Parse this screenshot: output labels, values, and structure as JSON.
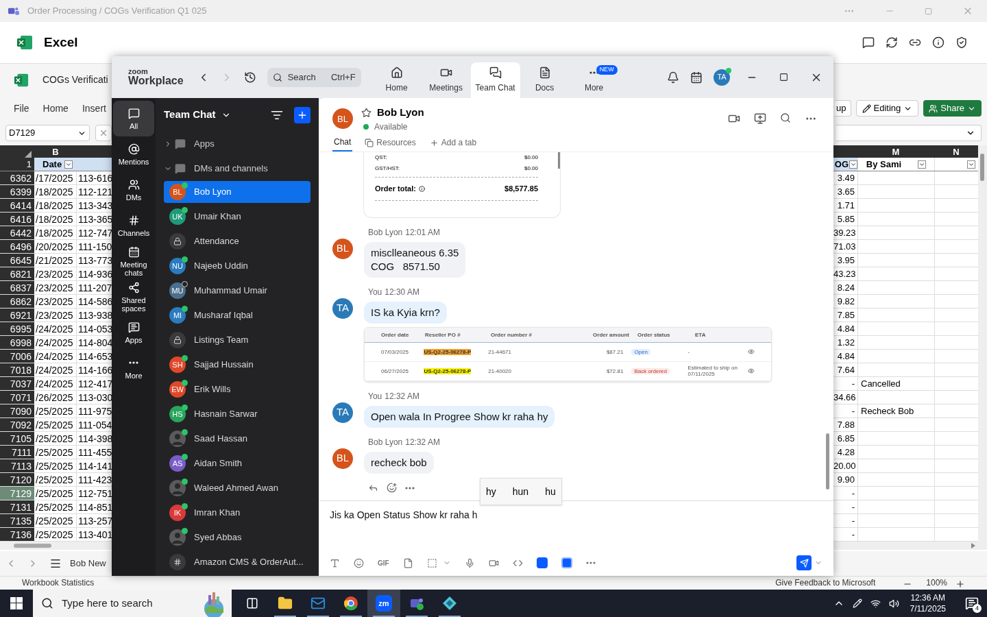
{
  "teams_title": "Order Processing / COGs Verification Q1 025",
  "excel": {
    "app_name": "Excel",
    "file_name": "COGs Verificati",
    "ribbon_tabs": [
      "File",
      "Home",
      "Insert"
    ],
    "up_button": "up",
    "editing_button": "Editing",
    "share_button": "Share",
    "name_box": "D7129",
    "columns": {
      "left": "B",
      "mid": "M",
      "right": "N"
    },
    "header": {
      "row": "1",
      "date": "Date",
      "col_l": "OG",
      "col_m": "By Sami"
    },
    "rows": [
      {
        "row": "6362",
        "date": "/17/2025",
        "order": "113-616",
        "cog": "3.49",
        "selected": false
      },
      {
        "row": "6399",
        "date": "/18/2025",
        "order": "112-121",
        "cog": "3.65",
        "selected": false
      },
      {
        "row": "6414",
        "date": "/18/2025",
        "order": "113-343",
        "cog": "1.71",
        "selected": false
      },
      {
        "row": "6416",
        "date": "/18/2025",
        "order": "113-365",
        "cog": "5.85",
        "selected": false
      },
      {
        "row": "6442",
        "date": "/18/2025",
        "order": "112-747",
        "cog": "39.23",
        "selected": false
      },
      {
        "row": "6496",
        "date": "/20/2025",
        "order": "111-150",
        "cog": "71.03",
        "selected": false
      },
      {
        "row": "6645",
        "date": "/21/2025",
        "order": "113-773",
        "cog": "3.95",
        "selected": false
      },
      {
        "row": "6821",
        "date": "/23/2025",
        "order": "114-936",
        "cog": "43.23",
        "selected": false
      },
      {
        "row": "6837",
        "date": "/23/2025",
        "order": "111-207",
        "cog": "8.24",
        "selected": false
      },
      {
        "row": "6862",
        "date": "/23/2025",
        "order": "114-586",
        "cog": "9.82",
        "selected": false
      },
      {
        "row": "6921",
        "date": "/23/2025",
        "order": "113-938",
        "cog": "7.85",
        "selected": false
      },
      {
        "row": "6995",
        "date": "/24/2025",
        "order": "114-053",
        "cog": "4.84",
        "selected": false
      },
      {
        "row": "6998",
        "date": "/24/2025",
        "order": "114-804",
        "cog": "1.32",
        "selected": false
      },
      {
        "row": "7006",
        "date": "/24/2025",
        "order": "114-653",
        "cog": "4.84",
        "selected": false
      },
      {
        "row": "7018",
        "date": "/24/2025",
        "order": "114-166",
        "cog": "7.64",
        "selected": false
      },
      {
        "row": "7037",
        "date": "/24/2025",
        "order": "112-417",
        "cog": "-",
        "note": "Cancelled",
        "selected": false
      },
      {
        "row": "7071",
        "date": "/26/2025",
        "order": "113-030",
        "cog": "34.66",
        "selected": false
      },
      {
        "row": "7090",
        "date": "/25/2025",
        "order": "111-975",
        "cog": "-",
        "note": "Recheck Bob",
        "selected": false
      },
      {
        "row": "7092",
        "date": "/25/2025",
        "order": "111-054",
        "cog": "7.88",
        "selected": false
      },
      {
        "row": "7105",
        "date": "/25/2025",
        "order": "114-398",
        "cog": "6.85",
        "selected": false
      },
      {
        "row": "7111",
        "date": "/25/2025",
        "order": "111-455",
        "cog": "4.28",
        "selected": false
      },
      {
        "row": "7113",
        "date": "/25/2025",
        "order": "114-141",
        "cog": "20.00",
        "selected": false
      },
      {
        "row": "7120",
        "date": "/25/2025",
        "order": "111-423",
        "cog": "9.90",
        "selected": false
      },
      {
        "row": "7129",
        "date": "/25/2025",
        "order": "112-751",
        "cog": "-",
        "selected": true
      },
      {
        "row": "7131",
        "date": "/25/2025",
        "order": "114-851",
        "cog": "-",
        "selected": false
      },
      {
        "row": "7135",
        "date": "/25/2025",
        "order": "113-257",
        "cog": "-",
        "selected": false
      },
      {
        "row": "7136",
        "date": "/25/2025",
        "order": "113-401",
        "cog": "-",
        "selected": false
      }
    ],
    "sheet_tab": "Bob New",
    "status_left": "Workbook Statistics",
    "feedback": "Give Feedback to Microsoft",
    "zoom_level": "100%"
  },
  "zoom": {
    "logo_top": "zoom",
    "logo_bottom": "Workplace",
    "search": {
      "placeholder": "Search",
      "shortcut": "Ctrl+F"
    },
    "nav": [
      {
        "label": "Home",
        "selected": false
      },
      {
        "label": "Meetings",
        "selected": false
      },
      {
        "label": "Team Chat",
        "selected": true
      },
      {
        "label": "Docs",
        "selected": false
      },
      {
        "label": "More",
        "badge": "NEW",
        "selected": false
      }
    ],
    "user_initials": "TA",
    "rail": [
      {
        "label": "All",
        "selected": true
      },
      {
        "label": "Mentions",
        "selected": false
      },
      {
        "label": "DMs",
        "selected": false
      },
      {
        "label": "Channels",
        "selected": false
      },
      {
        "label": "Meeting chats",
        "selected": false
      },
      {
        "label": "Shared spaces",
        "selected": false
      },
      {
        "label": "Apps",
        "selected": false
      },
      {
        "label": "More",
        "selected": false
      }
    ],
    "list_title": "Team Chat",
    "sections": [
      {
        "label": "Apps",
        "expanded": false
      },
      {
        "label": "DMs and channels",
        "expanded": true
      }
    ],
    "contacts": [
      {
        "kind": "initials",
        "name": "Bob Lyon",
        "initials": "BL",
        "color": "#d4541c",
        "online": true,
        "selected": true
      },
      {
        "kind": "initials",
        "name": "Umair Khan",
        "initials": "UK",
        "color": "#1e9a78",
        "online": true,
        "selected": false
      },
      {
        "kind": "channel",
        "name": "Attendance",
        "selected": false
      },
      {
        "kind": "initials",
        "name": "Najeeb Uddin",
        "initials": "NU",
        "color": "#2b7bbf",
        "online": true,
        "selected": false
      },
      {
        "kind": "initials",
        "name": "Muhammad Umair",
        "initials": "MU",
        "color": "#4b6f8c",
        "online": false,
        "selected": false
      },
      {
        "kind": "initials",
        "name": "Musharaf Iqbal",
        "initials": "MI",
        "color": "#2b7bbf",
        "online": true,
        "selected": false
      },
      {
        "kind": "channel",
        "name": "Listings Team",
        "selected": false
      },
      {
        "kind": "initials",
        "name": "Sajjad Hussain",
        "initials": "SH",
        "color": "#e0482a",
        "online": true,
        "selected": false
      },
      {
        "kind": "initials",
        "name": "Erik Wills",
        "initials": "EW",
        "color": "#e0482a",
        "online": true,
        "selected": false
      },
      {
        "kind": "initials",
        "name": "Hasnain Sarwar",
        "initials": "HS",
        "color": "#28a55c",
        "online": true,
        "selected": false
      },
      {
        "name": "Saad Hassan",
        "online": true,
        "selected": false
      },
      {
        "kind": "initials",
        "name": "Aidan Smith",
        "initials": "AS",
        "color": "#7b5cc6",
        "online": true,
        "selected": false
      },
      {
        "name": "Waleed Ahmed Awan",
        "online": true,
        "selected": false
      },
      {
        "kind": "initials",
        "name": "Imran Khan",
        "initials": "IK",
        "color": "#d93a3a",
        "online": true,
        "selected": false
      },
      {
        "name": "Syed Abbas",
        "online": true,
        "selected": false
      },
      {
        "kind": "hash",
        "name": "Amazon CMS & OrderAut...",
        "selected": false
      }
    ],
    "chat": {
      "name": "Bob Lyon",
      "initials": "BL",
      "color": "#d4541c",
      "status": "Available",
      "tabs": [
        {
          "label": "Chat",
          "selected": true
        },
        {
          "label": "Resources",
          "selected": false
        },
        {
          "label": "Add a tab",
          "selected": false
        }
      ],
      "messages": [
        {
          "kind": "order_card",
          "lines": [
            {
              "label": "QST:",
              "value": "$0.00"
            },
            {
              "label": "GST/HST:",
              "value": "$0.00"
            }
          ],
          "total_label": "Order total:",
          "total": "$8,577.85"
        },
        {
          "kind": "text",
          "sender": "Bob Lyon",
          "time": "12:01 AM",
          "initials": "BL",
          "color": "#d4541c",
          "mine": false,
          "lines": [
            "misclleaneous 6.35",
            "COG   8571.50"
          ],
          "actions": false
        },
        {
          "kind": "text",
          "sender": "You",
          "time": "12:30 AM",
          "initials": "TA",
          "color": "#2a7ab8",
          "mine": true,
          "lines": [
            "IS ka Kyia krn?"
          ],
          "actions": false,
          "attachment": {
            "columns": [
              "Order date",
              "Reseller PO #",
              "Order number #",
              "Order amount",
              "Order status",
              "ETA"
            ],
            "rows": [
              {
                "date": "07/03/2025",
                "po": "US-Q2-25-06278-P",
                "color": "#f0a030",
                "order": "21-44671",
                "amount": "$87.21",
                "status": "Open",
                "kind": "open",
                "eta": "-"
              },
              {
                "date": "06/27/2025",
                "po": "US-Q2-25-06278-P",
                "color": "#f5f000",
                "order": "21-40020",
                "amount": "$72.81",
                "status": "Back ordered",
                "kind": "back_ordered",
                "eta": "Estimated to ship on 07/11/2025"
              }
            ]
          }
        },
        {
          "kind": "text",
          "sender": "You",
          "time": "12:32 AM",
          "initials": "TA",
          "color": "#2a7ab8",
          "mine": true,
          "lines": [
            "Open wala In Progree Show kr raha hy"
          ],
          "actions": false
        },
        {
          "kind": "text",
          "sender": "Bob Lyon",
          "time": "12:32 AM",
          "initials": "BL",
          "color": "#d4541c",
          "mine": false,
          "lines": [
            "recheck bob"
          ],
          "actions": true
        }
      ],
      "suggestions": [
        "hy",
        "hun",
        "hu"
      ],
      "draft": "Jis ka Open Status Show kr raha h",
      "gif": "GIF"
    }
  },
  "taskbar": {
    "search_placeholder": "Type here to search",
    "apps": [
      {
        "kind": "taskview",
        "selected": false
      },
      {
        "kind": "explorer",
        "selected": false
      },
      {
        "kind": "outlook",
        "selected": false
      },
      {
        "kind": "chrome",
        "selected": false
      },
      {
        "kind": "zoom",
        "label": "zm",
        "selected": true
      },
      {
        "kind": "teams",
        "selected": false
      },
      {
        "kind": "diamond",
        "selected": false
      }
    ],
    "time": "12:36 AM",
    "date": "7/11/2025",
    "notifications": "4"
  }
}
